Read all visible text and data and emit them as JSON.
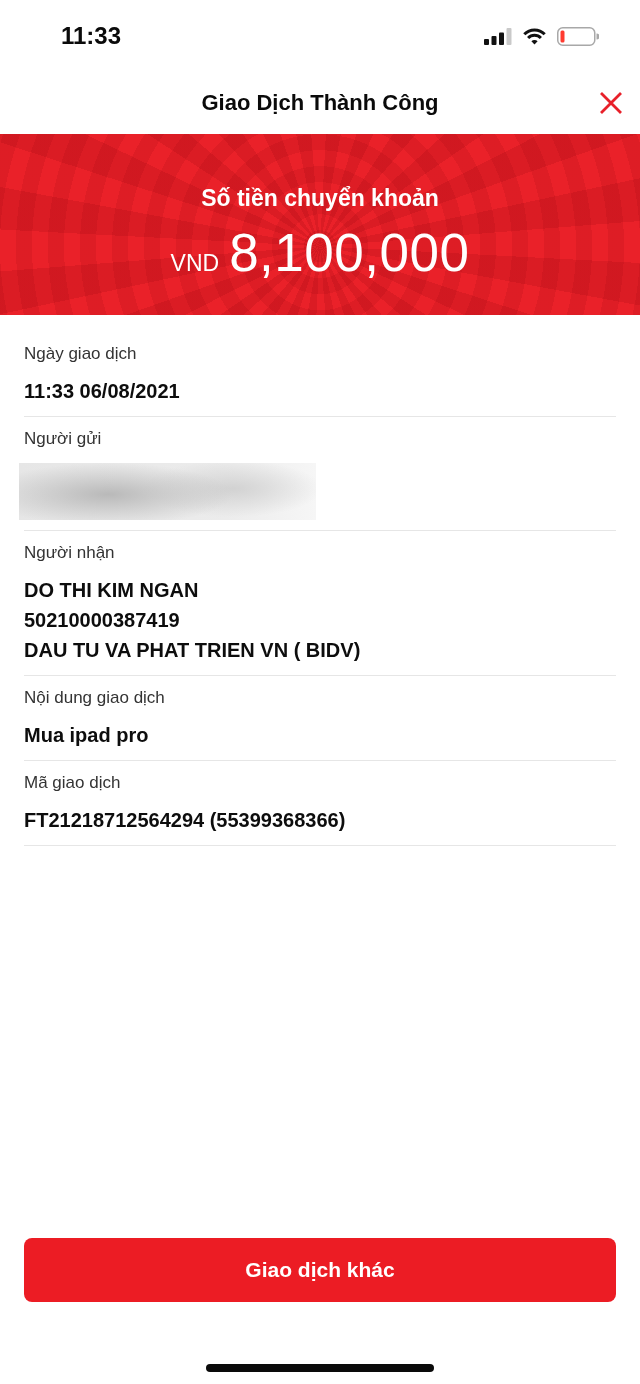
{
  "status_bar": {
    "time": "11:33"
  },
  "header": {
    "title": "Giao Dịch Thành Công"
  },
  "banner": {
    "label": "Số tiền chuyển khoản",
    "currency": "VND",
    "amount": "8,100,000"
  },
  "details": [
    {
      "kind": "text",
      "label": "Ngày giao dịch",
      "lines": [
        "11:33 06/08/2021"
      ]
    },
    {
      "kind": "redacted",
      "label": "Người gửi"
    },
    {
      "kind": "text",
      "label": "Người nhận",
      "lines": [
        "DO THI KIM NGAN",
        "50210000387419",
        "DAU TU VA PHAT TRIEN VN ( BIDV)"
      ]
    },
    {
      "kind": "text",
      "label": "Nội dung giao dịch",
      "lines": [
        "Mua ipad pro"
      ]
    },
    {
      "kind": "text",
      "label": "Mã giao dịch",
      "lines": [
        "FT21218712564294 (55399368366)"
      ]
    }
  ],
  "button": {
    "label": "Giao dịch khác"
  }
}
